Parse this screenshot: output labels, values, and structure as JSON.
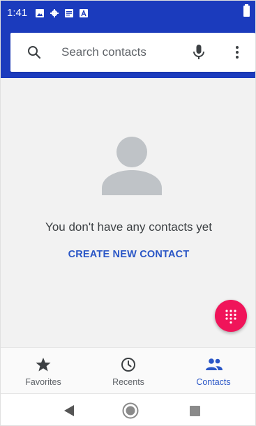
{
  "status_bar": {
    "time": "1:41",
    "icons": [
      "image-icon",
      "gear-icon",
      "notes-icon",
      "a-icon",
      "battery-icon"
    ]
  },
  "search": {
    "placeholder": "Search contacts",
    "icons": [
      "search-icon",
      "mic-icon",
      "more-vert-icon"
    ]
  },
  "empty_state": {
    "message": "You don't have any contacts yet",
    "action_label": "CREATE NEW CONTACT"
  },
  "fab": {
    "icon": "dialpad-icon",
    "color": "#f0145a"
  },
  "bottom_nav": {
    "items": [
      {
        "label": "Favorites",
        "icon": "star-icon",
        "active": false
      },
      {
        "label": "Recents",
        "icon": "clock-icon",
        "active": false
      },
      {
        "label": "Contacts",
        "icon": "people-icon",
        "active": true
      }
    ]
  },
  "system_nav": {
    "icons": [
      "back-icon",
      "home-icon",
      "recents-square-icon"
    ]
  },
  "colors": {
    "header": "#1b3bbd",
    "accent": "#2a56c6",
    "fab": "#f0145a",
    "background": "#f2f2f2"
  }
}
